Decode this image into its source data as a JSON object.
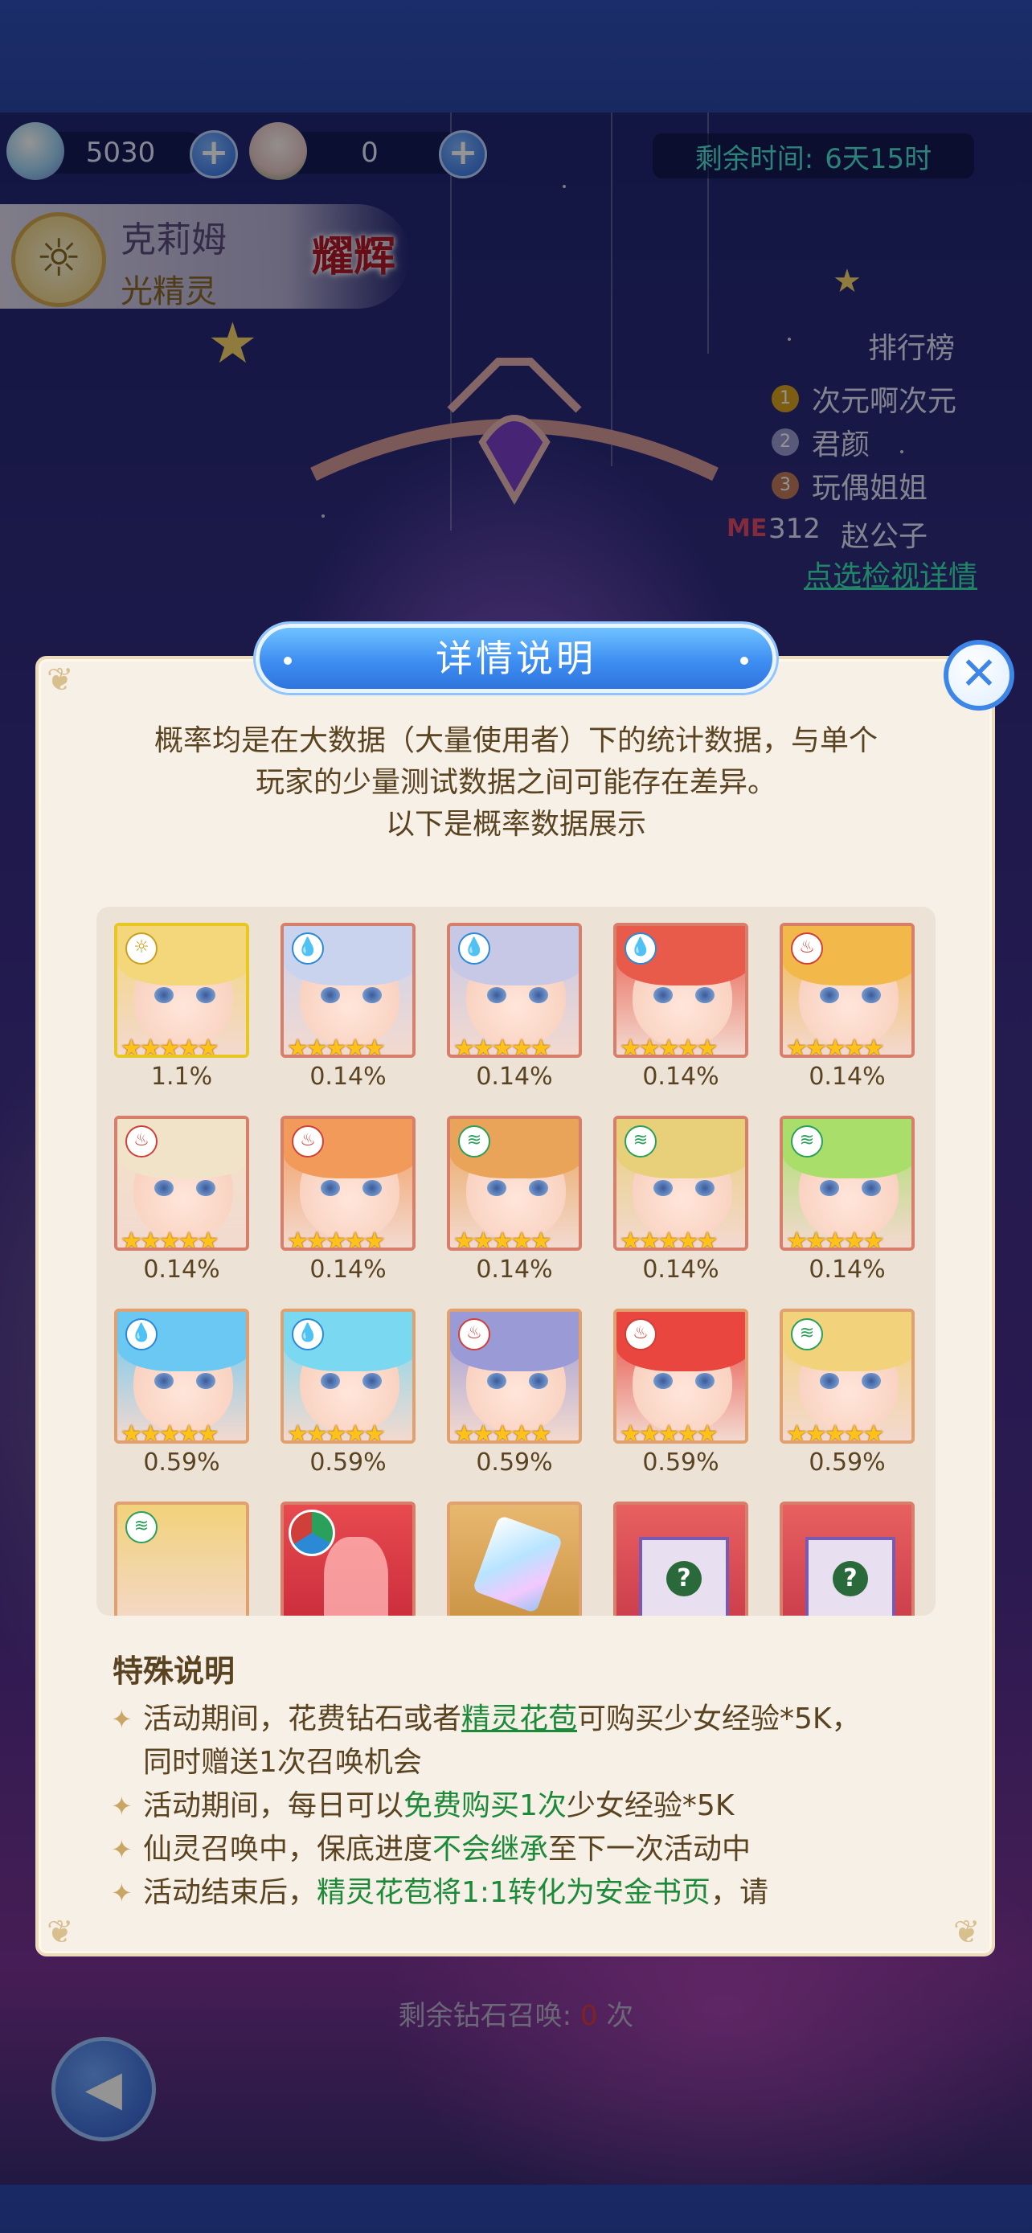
{
  "currency": {
    "diamond_value": "5030",
    "flower_value": "0"
  },
  "timer": {
    "label": "剩余时间:",
    "value": "6天15时"
  },
  "character": {
    "name": "克莉姆",
    "element": "光精灵",
    "badge": "耀辉"
  },
  "leaderboard": {
    "title": "排行榜",
    "rows": [
      {
        "rank": "1",
        "name": "次元啊次元"
      },
      {
        "rank": "2",
        "name": "君颜"
      },
      {
        "rank": "3",
        "name": "玩偶姐姐"
      }
    ],
    "me_tag": "ME",
    "me_rank": "312",
    "me_name": "赵公子",
    "link": "点选检视详情"
  },
  "bottom": {
    "prefix": "剩余钻石召唤:",
    "count": "0",
    "suffix": "次"
  },
  "modal": {
    "title": "详情说明",
    "intro": [
      "概率均是在大数据（大量使用者）下的统计数据，与单个",
      "玩家的少量测试数据之间可能存在差异。",
      "以下是概率数据展示"
    ],
    "rewards": [
      {
        "element": "light",
        "hair": "#f3d77a",
        "rate": "1.1%",
        "frame": "gold"
      },
      {
        "element": "water",
        "hair": "#c9d3ee",
        "rate": "0.14%",
        "frame": "red"
      },
      {
        "element": "water",
        "hair": "#c7c8e6",
        "rate": "0.14%",
        "frame": "red"
      },
      {
        "element": "water",
        "hair": "#e85a4a",
        "rate": "0.14%",
        "frame": "red"
      },
      {
        "element": "fire",
        "hair": "#f2b84a",
        "rate": "0.14%",
        "frame": "red"
      },
      {
        "element": "fire",
        "hair": "#f1e3c8",
        "rate": "0.14%",
        "frame": "red"
      },
      {
        "element": "fire",
        "hair": "#f29a5a",
        "rate": "0.14%",
        "frame": "red"
      },
      {
        "element": "wind",
        "hair": "#e9a45a",
        "rate": "0.14%",
        "frame": "red"
      },
      {
        "element": "wind",
        "hair": "#e8cf7a",
        "rate": "0.14%",
        "frame": "red"
      },
      {
        "element": "wind",
        "hair": "#a9de6a",
        "rate": "0.14%",
        "frame": "red"
      },
      {
        "element": "water",
        "hair": "#6ac8f2",
        "rate": "0.59%",
        "frame": "orange"
      },
      {
        "element": "water",
        "hair": "#7ad8f0",
        "rate": "0.59%",
        "frame": "orange"
      },
      {
        "element": "fire",
        "hair": "#9a9ad6",
        "rate": "0.59%",
        "frame": "orange"
      },
      {
        "element": "fire",
        "hair": "#e8463e",
        "rate": "0.59%",
        "frame": "orange"
      },
      {
        "element": "wind",
        "hair": "#f2d27a",
        "rate": "0.59%",
        "frame": "orange"
      }
    ],
    "partial_items": [
      {
        "kind": "girl",
        "element": "wind"
      },
      {
        "kind": "silhouette"
      },
      {
        "kind": "crystal"
      },
      {
        "kind": "giftbox"
      },
      {
        "kind": "giftbox"
      }
    ],
    "special_title": "特殊说明",
    "notes": [
      [
        {
          "t": "活动期间，花费钻石或者",
          "s": ""
        },
        {
          "t": "精灵花苞",
          "s": "hl u"
        },
        {
          "t": "可购买少女经验*5K，同时赠送1次召唤机会",
          "s": ""
        }
      ],
      [
        {
          "t": "活动期间，每日可以",
          "s": ""
        },
        {
          "t": "免费购买1次",
          "s": "hl"
        },
        {
          "t": "少女经验*5K",
          "s": ""
        }
      ],
      [
        {
          "t": "仙灵召唤中，保底进度",
          "s": ""
        },
        {
          "t": "不会继承",
          "s": "hl"
        },
        {
          "t": "至下一次活动中",
          "s": ""
        }
      ],
      [
        {
          "t": "活动结束后，",
          "s": ""
        },
        {
          "t": "精灵花苞将1:1转化为安金书页",
          "s": "hl"
        },
        {
          "t": "，请",
          "s": ""
        }
      ]
    ]
  },
  "colors": {
    "accent_blue": "#3d86e8",
    "highlight_green": "#1d8a3a",
    "timer_teal": "#4fe0d0",
    "star_gold": "#ffc21a"
  }
}
